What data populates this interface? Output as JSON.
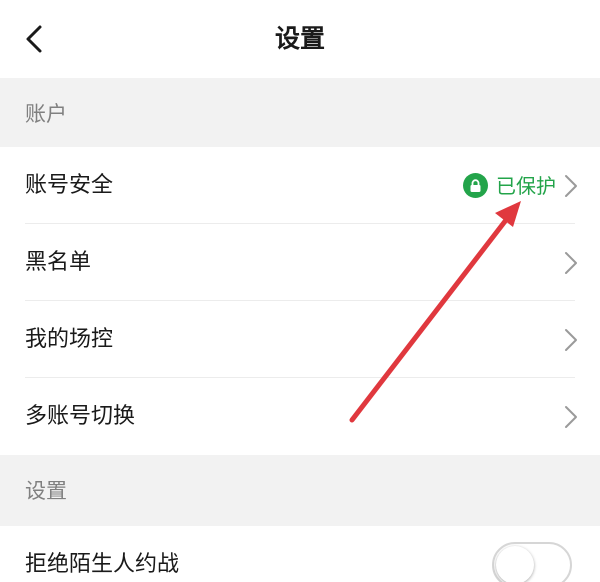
{
  "nav": {
    "title": "设置",
    "back_icon": "chevron-left-icon"
  },
  "sections": [
    {
      "header": "账户",
      "rows": [
        {
          "label": "账号安全",
          "status": "已保护",
          "status_icon": "lock-icon",
          "status_color": "#23a44a"
        },
        {
          "label": "黑名单"
        },
        {
          "label": "我的场控"
        },
        {
          "label": "多账号切换"
        }
      ]
    },
    {
      "header": "设置",
      "rows": [
        {
          "label": "拒绝陌生人约战",
          "toggle_on": false
        }
      ]
    }
  ],
  "colors": {
    "accent_green": "#23a44a",
    "annotation_arrow": "#e0383e",
    "section_bg": "#f2f2f2"
  }
}
